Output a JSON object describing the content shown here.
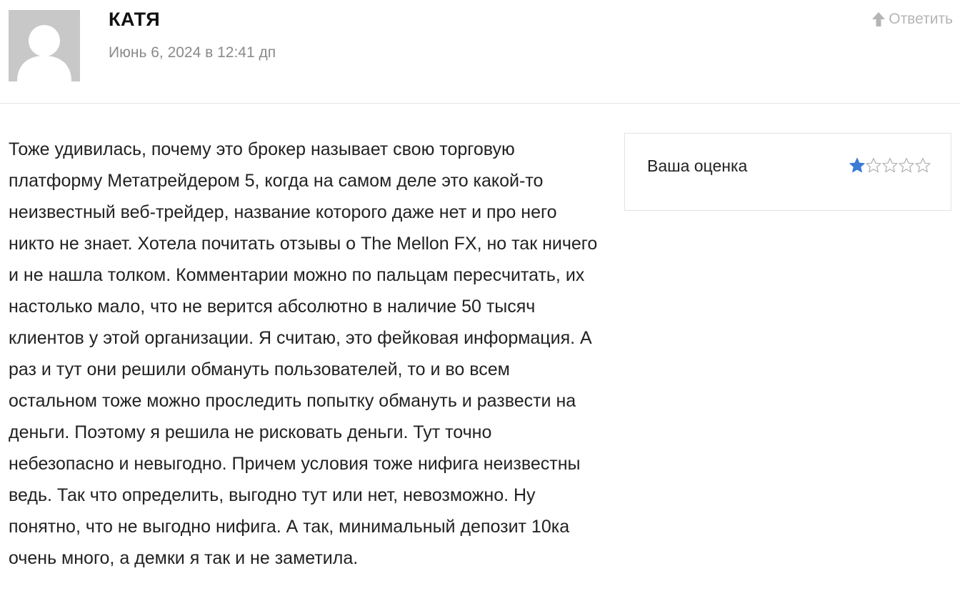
{
  "comment": {
    "author": "КАТЯ",
    "date": "Июнь 6, 2024 в 12:41 дп",
    "reply_label": "Ответить",
    "text": "Тоже удивилась, почему это брокер называет свою торговую платформу Метатрейдером 5, когда на самом деле это какой-то неизвестный веб-трейдер, название которого даже нет и про него никто не знает. Хотела почитать отзывы о The Mellon FX, но так ничего и не нашла толком. Комментарии можно по пальцам пересчитать, их настолько мало, что не верится абсолютно в наличие 50 тысяч клиентов у этой организации. Я считаю, это фейковая информация. А раз и тут они решили обмануть пользователей, то и во всем остальном тоже можно проследить попытку обмануть и развести на деньги. Поэтому я решила не рисковать деньги. Тут точно небезопасно и невыгодно. Причем условия тоже нифига неизвестны ведь. Так что определить, выгодно тут или нет, невозможно. Ну понятно, что не выгодно нифига. А так, минимальный депозит 10ка очень много, а демки я так и не заметила."
  },
  "rating": {
    "label": "Ваша оценка",
    "value": 1,
    "max": 5,
    "filled_color": "#3a7bd5",
    "empty_color": "#b0b0b0"
  },
  "icons": {
    "avatar": "default-user-icon",
    "reply": "arrow-up-icon",
    "star": "star-icon"
  },
  "colors": {
    "avatar_bg": "#c8c8c8",
    "muted_text": "#8a8a8a",
    "reply_text": "#b5b5b5"
  }
}
